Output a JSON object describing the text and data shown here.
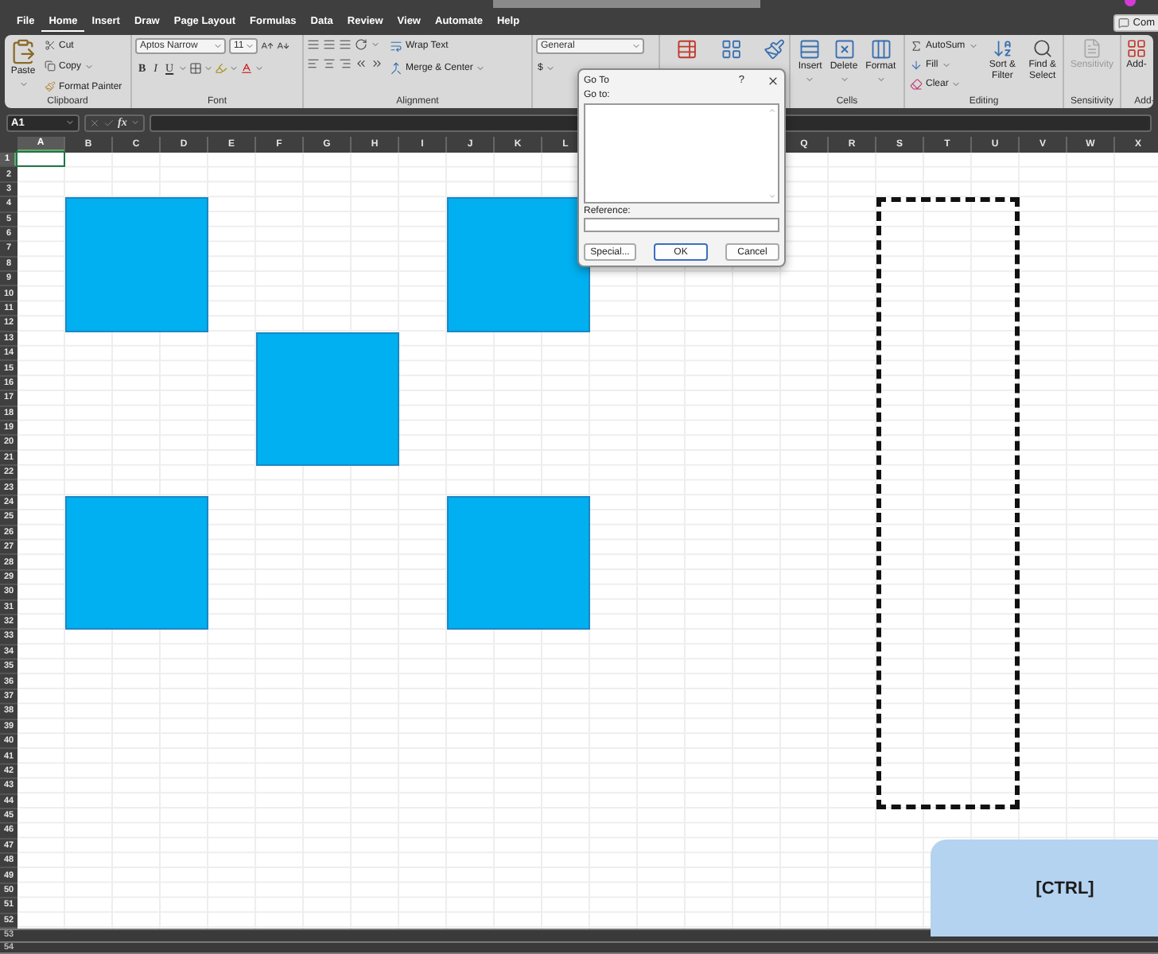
{
  "title_bar": {
    "comment_button": "Com"
  },
  "menu_tabs": [
    {
      "label": "File",
      "selected": false
    },
    {
      "label": "Home",
      "selected": true
    },
    {
      "label": "Insert",
      "selected": false
    },
    {
      "label": "Draw",
      "selected": false
    },
    {
      "label": "Page Layout",
      "selected": false
    },
    {
      "label": "Formulas",
      "selected": false
    },
    {
      "label": "Data",
      "selected": false
    },
    {
      "label": "Review",
      "selected": false
    },
    {
      "label": "View",
      "selected": false
    },
    {
      "label": "Automate",
      "selected": false
    },
    {
      "label": "Help",
      "selected": false
    }
  ],
  "ribbon": {
    "clipboard": {
      "label": "Clipboard",
      "paste": "Paste",
      "cut": "Cut",
      "copy": "Copy",
      "format_painter": "Format Painter"
    },
    "font": {
      "label": "Font",
      "font_name": "Aptos Narrow",
      "font_size": "11",
      "bold": "B",
      "italic": "I",
      "underline": "U"
    },
    "alignment": {
      "label": "Alignment",
      "wrap_text": "Wrap Text",
      "merge_center": "Merge & Center"
    },
    "number": {
      "format": "General",
      "currency": "$"
    },
    "cells": {
      "label": "Cells",
      "buttons": [
        "Insert",
        "Delete",
        "Format"
      ]
    },
    "editing": {
      "label": "Editing",
      "autosum": "AutoSum",
      "fill": "Fill",
      "clear": "Clear",
      "sort_filter": "Sort & Filter",
      "find_select": "Find & Select"
    },
    "sensitivity": {
      "label": "Sensitivity",
      "button": "Sensitivity"
    },
    "add_ins": {
      "label": "Add-",
      "button": "Add-"
    }
  },
  "formula_bar": {
    "name_box": "A1",
    "function_label": "fx"
  },
  "sheet": {
    "columns_left": [
      {
        "label": "A",
        "selected": true
      },
      {
        "label": "B",
        "selected": false
      },
      {
        "label": "C",
        "selected": false
      },
      {
        "label": "D",
        "selected": false
      },
      {
        "label": "E",
        "selected": false
      },
      {
        "label": "F",
        "selected": false
      },
      {
        "label": "G",
        "selected": false
      },
      {
        "label": "H",
        "selected": false
      },
      {
        "label": "I",
        "selected": false
      },
      {
        "label": "J",
        "selected": false
      },
      {
        "label": "K",
        "selected": false
      },
      {
        "label": "L",
        "selected": false
      }
    ],
    "columns_right": [
      {
        "label": "Q",
        "selected": false
      },
      {
        "label": "R",
        "selected": false
      },
      {
        "label": "S",
        "selected": false
      },
      {
        "label": "T",
        "selected": false
      },
      {
        "label": "U",
        "selected": false
      },
      {
        "label": "V",
        "selected": false
      },
      {
        "label": "W",
        "selected": false
      },
      {
        "label": "X",
        "selected": false
      }
    ],
    "rows": [
      {
        "label": "1",
        "selected": true
      },
      {
        "label": "2",
        "selected": false
      },
      {
        "label": "3",
        "selected": false
      },
      {
        "label": "4",
        "selected": false
      },
      {
        "label": "5",
        "selected": false
      },
      {
        "label": "6",
        "selected": false
      },
      {
        "label": "7",
        "selected": false
      },
      {
        "label": "8",
        "selected": false
      },
      {
        "label": "9",
        "selected": false
      },
      {
        "label": "10",
        "selected": false
      },
      {
        "label": "11",
        "selected": false
      },
      {
        "label": "12",
        "selected": false
      },
      {
        "label": "13",
        "selected": false
      },
      {
        "label": "14",
        "selected": false
      },
      {
        "label": "15",
        "selected": false
      },
      {
        "label": "16",
        "selected": false
      },
      {
        "label": "17",
        "selected": false
      },
      {
        "label": "18",
        "selected": false
      },
      {
        "label": "19",
        "selected": false
      },
      {
        "label": "20",
        "selected": false
      },
      {
        "label": "21",
        "selected": false
      },
      {
        "label": "22",
        "selected": false
      },
      {
        "label": "23",
        "selected": false
      },
      {
        "label": "24",
        "selected": false
      },
      {
        "label": "25",
        "selected": false
      },
      {
        "label": "26",
        "selected": false
      },
      {
        "label": "27",
        "selected": false
      },
      {
        "label": "28",
        "selected": false
      },
      {
        "label": "29",
        "selected": false
      },
      {
        "label": "30",
        "selected": false
      },
      {
        "label": "31",
        "selected": false
      },
      {
        "label": "32",
        "selected": false
      },
      {
        "label": "33",
        "selected": false
      },
      {
        "label": "34",
        "selected": false
      },
      {
        "label": "35",
        "selected": false
      },
      {
        "label": "36",
        "selected": false
      },
      {
        "label": "37",
        "selected": false
      },
      {
        "label": "38",
        "selected": false
      },
      {
        "label": "39",
        "selected": false
      },
      {
        "label": "40",
        "selected": false
      },
      {
        "label": "41",
        "selected": false
      },
      {
        "label": "42",
        "selected": false
      },
      {
        "label": "43",
        "selected": false
      },
      {
        "label": "44",
        "selected": false
      },
      {
        "label": "45",
        "selected": false
      },
      {
        "label": "46",
        "selected": false
      },
      {
        "label": "47",
        "selected": false
      },
      {
        "label": "48",
        "selected": false
      },
      {
        "label": "49",
        "selected": false
      },
      {
        "label": "50",
        "selected": false
      },
      {
        "label": "51",
        "selected": false
      },
      {
        "label": "52",
        "selected": false
      }
    ],
    "bottom_rows": [
      "53",
      "54"
    ],
    "shapes": [
      {
        "kind": "filled"
      },
      {
        "kind": "filled"
      },
      {
        "kind": "filled"
      },
      {
        "kind": "filled"
      },
      {
        "kind": "filled"
      },
      {
        "kind": "dashed"
      }
    ]
  },
  "go_to_dialog": {
    "title": "Go To",
    "help": "?",
    "go_to_label": "Go to:",
    "reference_label": "Reference:",
    "buttons": [
      {
        "label": "Special...",
        "default": false
      },
      {
        "label": "OK",
        "default": true
      },
      {
        "label": "Cancel",
        "default": false
      }
    ]
  },
  "key_overlay": {
    "label": "[CTRL]"
  }
}
